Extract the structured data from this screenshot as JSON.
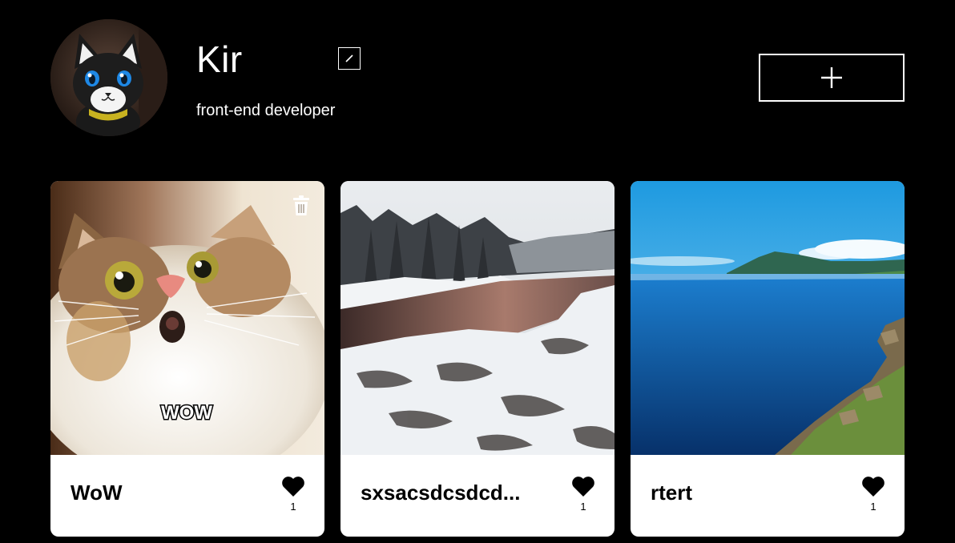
{
  "profile": {
    "name": "Kir",
    "about": "front-end developer",
    "avatar_icon": "cat-avatar"
  },
  "toolbar": {
    "edit_icon": "pencil-icon",
    "add_icon": "plus-icon"
  },
  "cards": [
    {
      "title": "WoW",
      "likes": "1",
      "image_caption": "WOW",
      "image_subject": "surprised-cat",
      "deletable": true
    },
    {
      "title": "sxsacsdcsdcd...",
      "likes": "1",
      "image_subject": "snowy-river",
      "deletable": false
    },
    {
      "title": "rtert",
      "likes": "1",
      "image_subject": "blue-lake",
      "deletable": false
    }
  ],
  "colors": {
    "page_background": "#000000",
    "card_background": "#ffffff",
    "text_light": "#ffffff",
    "text_dark": "#000000"
  }
}
